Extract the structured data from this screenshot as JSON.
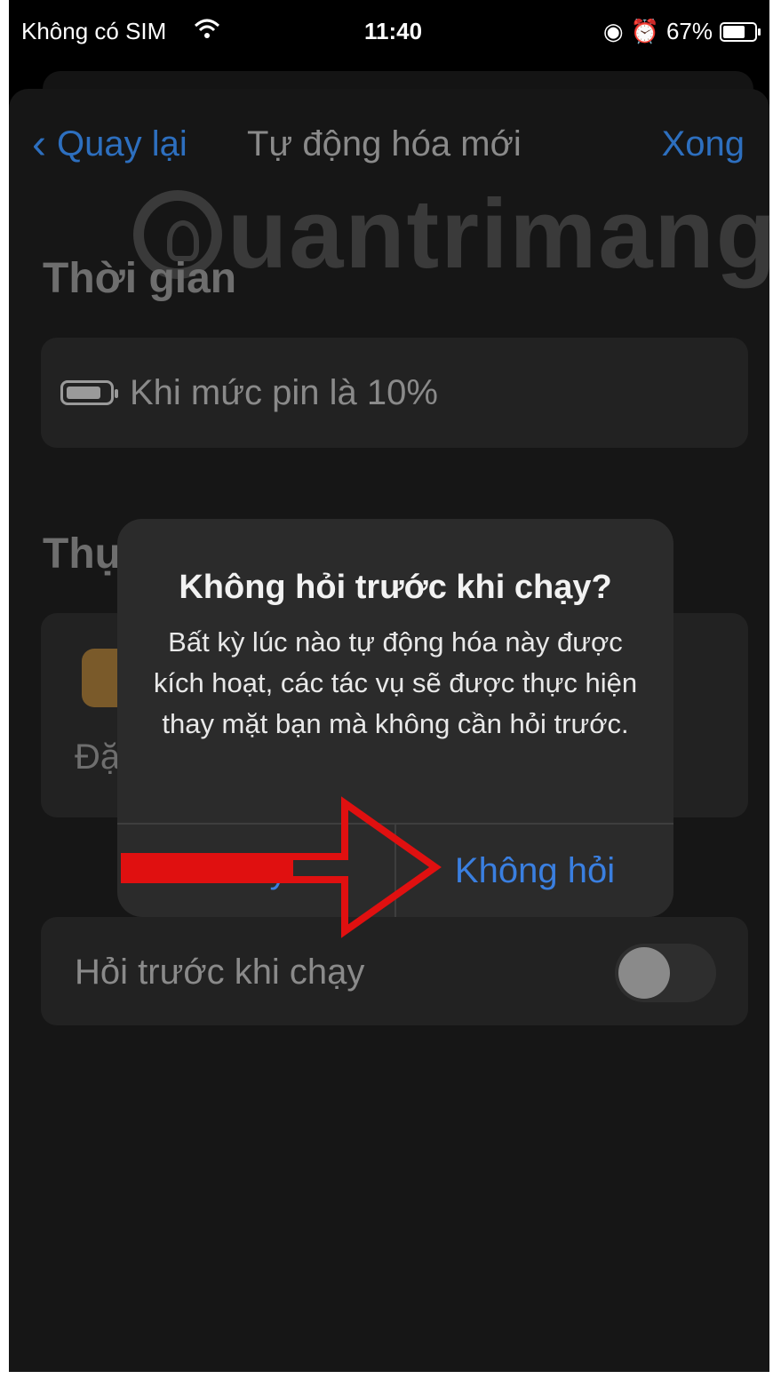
{
  "status_bar": {
    "carrier": "Không có SIM",
    "time": "11:40",
    "battery_percent": "67%"
  },
  "nav": {
    "back_label": "Quay lại",
    "title": "Tự động hóa mới",
    "done_label": "Xong"
  },
  "watermark": {
    "text": "uantrimang"
  },
  "sections": {
    "time_title": "Thời gian",
    "trigger_text": "Khi mức pin là 10%",
    "actions_title_partial": "Thự",
    "action_text_partial": "Đặ"
  },
  "ask_before_running": {
    "label": "Hỏi trước khi chạy",
    "enabled": false
  },
  "alert": {
    "title": "Không hỏi trước khi chạy?",
    "message": "Bất kỳ lúc nào tự động hóa này được kích hoạt, các tác vụ sẽ được thực hiện thay mặt bạn mà không cần hỏi trước.",
    "cancel_label": "Hủy",
    "confirm_label": "Không hỏi"
  },
  "colors": {
    "accent": "#2d6fbf",
    "annotation_arrow": "#e01010"
  }
}
